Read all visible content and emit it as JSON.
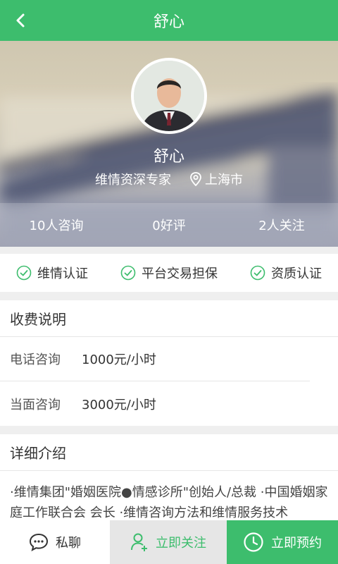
{
  "header": {
    "title": "舒心"
  },
  "profile": {
    "name": "舒心",
    "role": "维情资深专家",
    "location": "上海市"
  },
  "stats": [
    "10人咨询",
    "0好评",
    "2人关注"
  ],
  "badges": [
    "维情认证",
    "平台交易担保",
    "资质认证"
  ],
  "fees": {
    "title": "收费说明",
    "rows": [
      {
        "label": "电话咨询",
        "value": "1000元/小时"
      },
      {
        "label": "当面咨询",
        "value": "3000元/小时"
      }
    ]
  },
  "intro": {
    "title": "详细介绍",
    "text": "·维情集团\"婚姻医院●情感诊所\"创始人/总裁 ·中国婚姻家庭工作联合会 会长 ·维情咨询方法和维情服务技术"
  },
  "bottombar": {
    "chat": "私聊",
    "follow": "立即关注",
    "book": "立即预约"
  },
  "colors": {
    "brand": "#3dbd6d"
  },
  "icons": [
    "back-arrow-icon",
    "location-pin-icon",
    "check-circle-icon",
    "chat-bubble-icon",
    "add-user-icon",
    "clock-icon"
  ]
}
